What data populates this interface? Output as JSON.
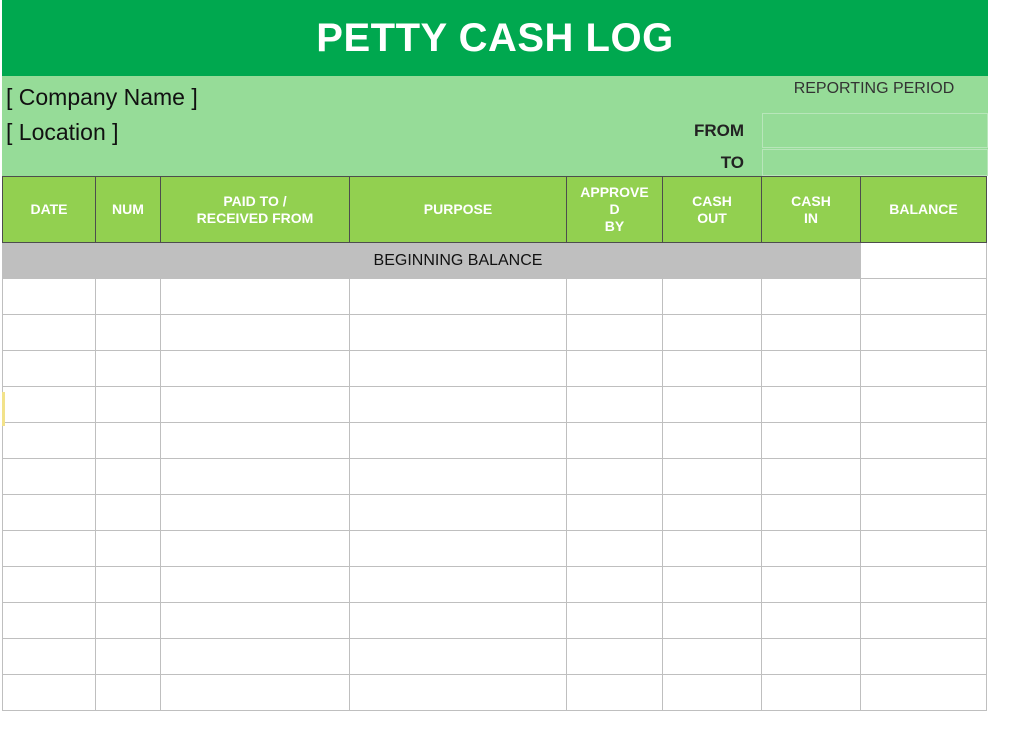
{
  "header": {
    "title": "PETTY CASH LOG"
  },
  "info": {
    "company": "[ Company Name ]",
    "location": "[ Location ]",
    "reporting_period": "REPORTING PERIOD",
    "from_label": "FROM",
    "to_label": "TO",
    "from_value": "",
    "to_value": ""
  },
  "table": {
    "columns": [
      "DATE",
      "NUM",
      "PAID TO /\nRECEIVED FROM",
      "PURPOSE",
      "APPROVE\nD\nBY",
      "CASH\nOUT",
      "CASH\nIN",
      "BALANCE"
    ],
    "beginning_label": "BEGINNING BALANCE",
    "empty_rows": 12
  },
  "colors": {
    "title": "#00a84f",
    "band": "#96dc98",
    "header": "#92d050",
    "begin_row": "#bfbfbf"
  }
}
